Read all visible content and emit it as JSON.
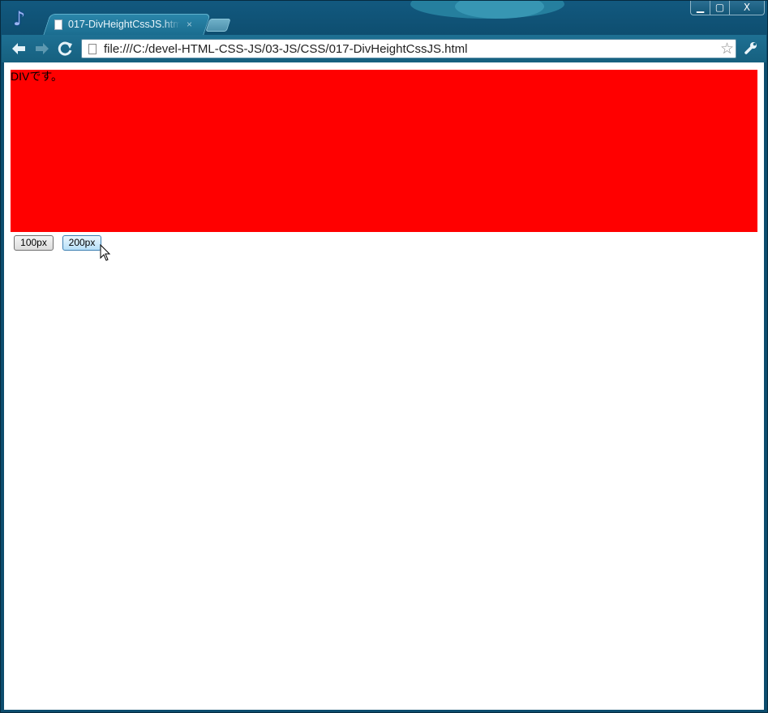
{
  "browser": {
    "tab_title": "017-DivHeightCssJS.html",
    "tab_close_glyph": "×",
    "url": "file:///C:/devel-HTML-CSS-JS/03-JS/CSS/017-DivHeightCssJS.html",
    "window_controls": {
      "minimize_glyph": "▁",
      "maximize_glyph": "▢",
      "close_glyph": "X"
    },
    "icons": {
      "app_logo": "music-note-icon",
      "back": "back-arrow-icon",
      "forward": "forward-arrow-icon",
      "reload": "reload-icon",
      "bookmark": "star-icon",
      "menu": "wrench-icon",
      "page": "page-icon"
    }
  },
  "page": {
    "div_text": "DIVです。",
    "div_color": "#ff0000",
    "buttons": {
      "b100": "100px",
      "b200": "200px"
    }
  }
}
